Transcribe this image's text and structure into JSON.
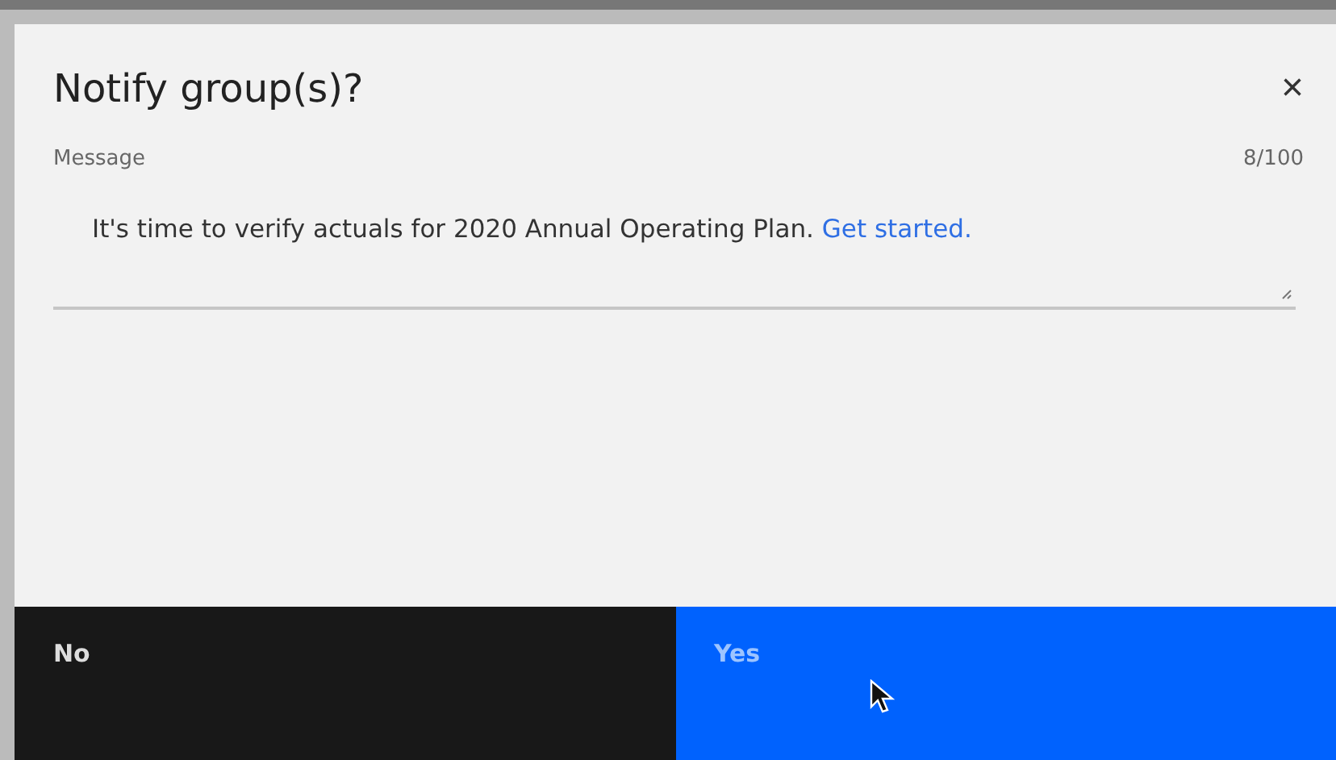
{
  "dialog": {
    "title": "Notify group(s)?",
    "close": "×"
  },
  "message": {
    "label": "Message",
    "counter": "8/100",
    "text": "It's time to verify actuals for 2020 Annual Operating Plan.",
    "link": "Get started."
  },
  "buttons": [
    {
      "label": "No",
      "kind": "secondary"
    },
    {
      "label": "Yes",
      "kind": "primary"
    }
  ]
}
